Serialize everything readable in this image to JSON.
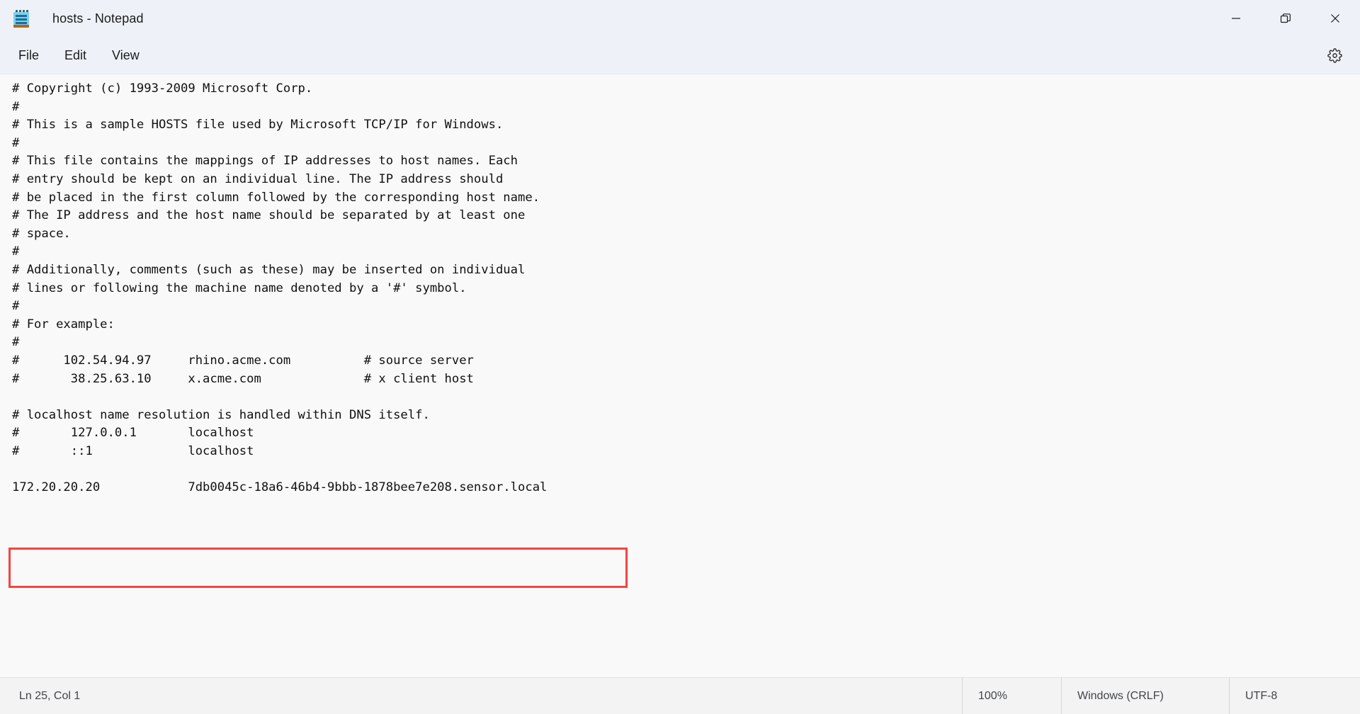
{
  "window": {
    "title": "hosts - Notepad",
    "icon": "notepad-icon",
    "controls": {
      "minimize": "minimize-icon",
      "restore": "restore-icon",
      "close": "close-icon"
    }
  },
  "menubar": {
    "items": [
      {
        "label": "File"
      },
      {
        "label": "Edit"
      },
      {
        "label": "View"
      }
    ],
    "settings_icon": "gear-icon"
  },
  "editor": {
    "content": "# Copyright (c) 1993-2009 Microsoft Corp.\n#\n# This is a sample HOSTS file used by Microsoft TCP/IP for Windows.\n#\n# This file contains the mappings of IP addresses to host names. Each\n# entry should be kept on an individual line. The IP address should\n# be placed in the first column followed by the corresponding host name.\n# The IP address and the host name should be separated by at least one\n# space.\n#\n# Additionally, comments (such as these) may be inserted on individual\n# lines or following the machine name denoted by a '#' symbol.\n#\n# For example:\n#\n#      102.54.94.97     rhino.acme.com          # source server\n#       38.25.63.10     x.acme.com              # x client host\n\n# localhost name resolution is handled within DNS itself.\n#\t127.0.0.1       localhost\n#\t::1             localhost\n\n172.20.20.20            7db0045c-18a6-46b4-9bbb-1878bee7e208.sensor.local",
    "highlight": {
      "color": "#f5443f",
      "line_text": "172.20.20.20            7db0045c-18a6-46b4-9bbb-1878bee7e208.sensor.local"
    }
  },
  "statusbar": {
    "cursor": "Ln 25, Col 1",
    "zoom": "100%",
    "line_ending": "Windows (CRLF)",
    "encoding": "UTF-8"
  }
}
